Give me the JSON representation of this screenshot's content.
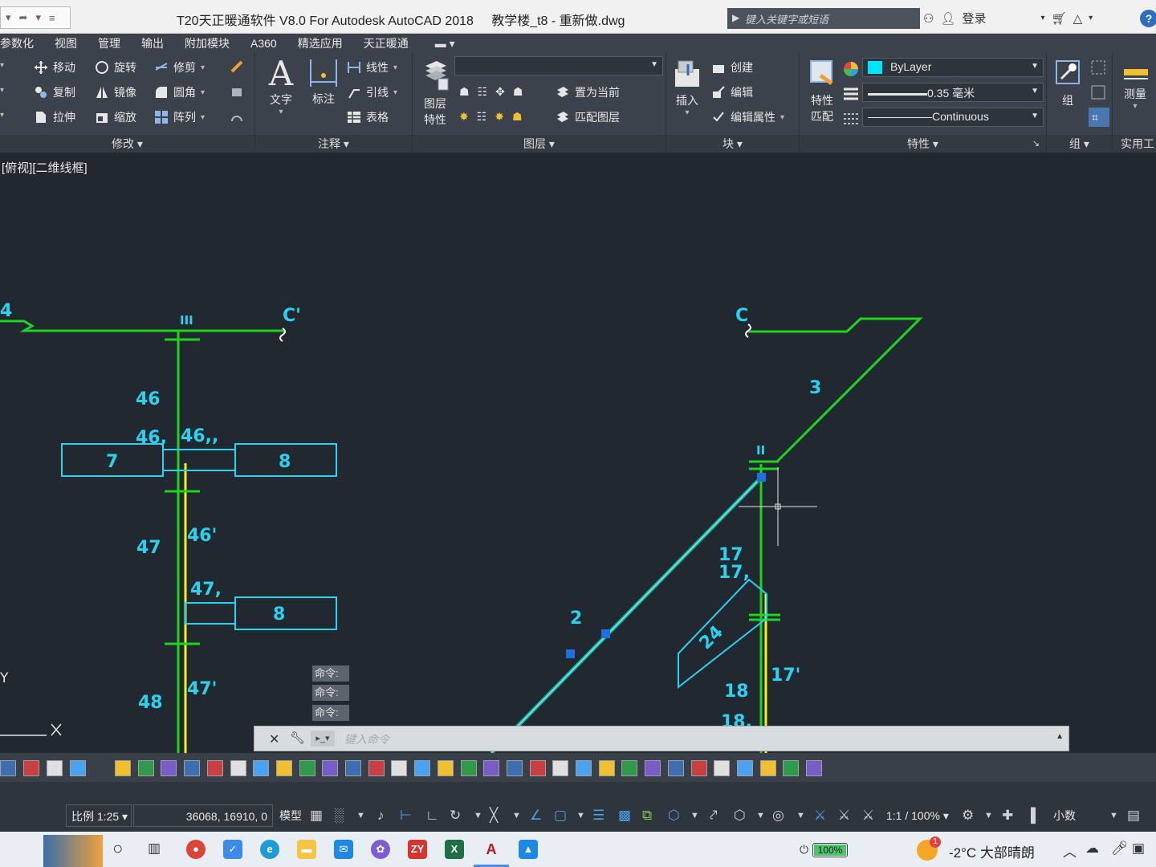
{
  "window": {
    "title": "T20天正暖通软件 V8.0 For Autodesk AutoCAD 2018",
    "file": "教学楼_t8 - 重新做.dwg",
    "search_placeholder": "键入关键字或短语",
    "login": "登录",
    "help": "?"
  },
  "menu": [
    "参数化",
    "视图",
    "管理",
    "输出",
    "附加模块",
    "A360",
    "精选应用",
    "天正暖通"
  ],
  "ribbon": {
    "modify": {
      "title": "修改",
      "move": "移动",
      "rotate": "旋转",
      "trim": "修剪",
      "copy": "复制",
      "mirror": "镜像",
      "fillet": "圆角",
      "stretch": "拉伸",
      "scale": "缩放",
      "array": "阵列"
    },
    "annotation": {
      "title": "注释",
      "text": "文字",
      "dimension": "标注",
      "linear": "线性",
      "leader": "引线",
      "table": "表格"
    },
    "layers": {
      "title": "图层",
      "properties_line1": "图层",
      "properties_line2": "特性",
      "set_current": "置为当前",
      "match_layer": "匹配图层"
    },
    "block": {
      "title": "块",
      "insert": "插入",
      "create": "创建",
      "edit": "编辑",
      "edit_attributes": "编辑属性"
    },
    "properties": {
      "title": "特性",
      "match_line1": "特性",
      "match_line2": "匹配",
      "color": "ByLayer",
      "lineweight": "0.35 毫米",
      "linetype": "Continuous"
    },
    "groups": {
      "title": "组",
      "group": "组"
    },
    "utilities": {
      "title": "实用工",
      "measure": "测量"
    }
  },
  "viewport": {
    "label": "[俯视][二维线框]",
    "axis_y": "Y",
    "labels": {
      "riser_left": "4",
      "node_III": "III",
      "c_prime": "C'",
      "c": "C",
      "seg_46": "46",
      "seg_46a": "46,",
      "seg_46b": "46,,",
      "box_7": "7",
      "box_8a": "8",
      "seg_46p": "46'",
      "seg_47": "47",
      "seg_47a": "47,",
      "box_8b": "8",
      "seg_47p": "47'",
      "seg_48": "48",
      "seg_3": "3",
      "node_II": "II",
      "seg_17": "17",
      "seg_17a": "17,",
      "seg_2": "2",
      "seg_24": "24",
      "seg_17p": "17'",
      "seg_18": "18",
      "seg_18a": "18,"
    }
  },
  "colors": {
    "background": "#212830",
    "pipe_green": "#1ed51e",
    "pipe_yellow": "#f2f21a",
    "pipe_selected": "#1aa89a",
    "text_cyan": "#26d3f0",
    "grip_blue": "#1f6fe0"
  },
  "command": {
    "history": [
      "命令:",
      "命令:",
      "命令:"
    ],
    "placeholder": "键入命令"
  },
  "statusbar": {
    "scale": "比例 1:25",
    "coords": "36068, 16910, 0",
    "model": "模型",
    "annotation_scale": "1:1 / 100%",
    "units": "小数"
  },
  "taskbar": {
    "battery": "100%",
    "weather": "-2°C  大部晴朗",
    "badge": "1"
  }
}
